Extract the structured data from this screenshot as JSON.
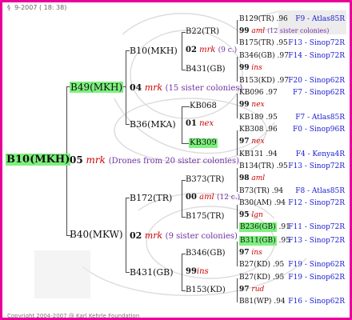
{
  "header": {
    "date": "§  9-2007 ( 18: 38)"
  },
  "footer": {
    "copyright": "Copyright 2004-2007 @ Karl Kehrle Foundation"
  },
  "colors": {
    "border": "#e8009a",
    "highlight": "#7ef07e",
    "year_mark": "#cc0000",
    "lineage_text": "#7030a0",
    "location": "#1a1ad0"
  },
  "root": {
    "name": "B10(MKH)"
  },
  "g1": {
    "mid": {
      "year": "05",
      "breed": "mrk",
      "note": "(Drones from 20 sister colonies)"
    },
    "top": {
      "name": "B49(MKH)"
    },
    "bottom": {
      "name": "B40(MKW)"
    }
  },
  "g2": {
    "top": {
      "year": "04",
      "breed": "mrk",
      "note": "(15 sister colonies)"
    },
    "bottom": {
      "year": "02",
      "breed": "mrk",
      "note": "(9 sister colonies)"
    },
    "n1": "B10(MKH)",
    "n2": "B36(MKA)",
    "n3": "B172(TR)",
    "n4": "B431(GB)"
  },
  "g3": {
    "a": {
      "year": "02",
      "breed": "mrk",
      "note": "(9 c.)"
    },
    "b": {
      "year": "01",
      "breed": "nex"
    },
    "c": {
      "year": "00",
      "breed": "aml",
      "note": "(12 c.)"
    },
    "d": {
      "year": "99",
      "breed": "ins"
    },
    "n1": "B22(TR)",
    "n2": "B431(GB)",
    "n3": "KB068",
    "n4": "KB309",
    "n5": "B373(TR)",
    "n6": "B175(TR)",
    "n7": "B346(GB)",
    "n8": "B153(KD)"
  },
  "g4": [
    {
      "left": "B129(TR)",
      "rate": ".96",
      "right": "F9 - Atlas85R"
    },
    {
      "year": "99",
      "breed": "aml",
      "note": "(12 sister colonies)"
    },
    {
      "left": "B175(TR)",
      "rate": ".95",
      "right": "F13 - Sinop72R"
    },
    {
      "left": "B346(GB)",
      "rate": ".97",
      "right": "F14 - Sinop72R"
    },
    {
      "year": "99",
      "breed": "ins"
    },
    {
      "left": "B153(KD)",
      "rate": ".97",
      "right": "F20 - Sinop62R"
    },
    {
      "left": "KB096",
      "rate": ".97",
      "right": "F7 - Sinop62R"
    },
    {
      "year": "99",
      "breed": "nex"
    },
    {
      "left": "KB189",
      "rate": ".95",
      "right": "F7 - Atlas85R"
    },
    {
      "left": "KB308",
      "rate": ".96",
      "right": "F0 - Sinop96R"
    },
    {
      "year": "97",
      "breed": "nex"
    },
    {
      "left": "KB131",
      "rate": ".94",
      "right": "F4 - Kenya4R"
    },
    {
      "left": "B134(TR)",
      "rate": ".95",
      "right": "F13 - Sinop72R"
    },
    {
      "year": "98",
      "breed": "aml"
    },
    {
      "left": "B73(TR)",
      "rate": ".94",
      "right": "F8 - Atlas85R"
    },
    {
      "left": "B30(AM)",
      "rate": ".94",
      "right": "F12 - Sinop72R"
    },
    {
      "year": "95",
      "breed": "lgn"
    },
    {
      "left": "B236(GB)",
      "rate": ".91",
      "right": "F11 - Sinop72R"
    },
    {
      "left": "B311(GB)",
      "rate": ".95",
      "right": "F13 - Sinop72R"
    },
    {
      "year": "97",
      "breed": "ins"
    },
    {
      "left": "B27(KD)",
      "rate": ".95",
      "right": "F19 - Sinop62R"
    },
    {
      "left": "B27(KD)",
      "rate": ".95",
      "right": "F19 - Sinop62R"
    },
    {
      "year": "97",
      "breed": "rud"
    },
    {
      "left": "B81(WP)",
      "rate": ".94",
      "right": "F16 - Sinop62R"
    }
  ]
}
